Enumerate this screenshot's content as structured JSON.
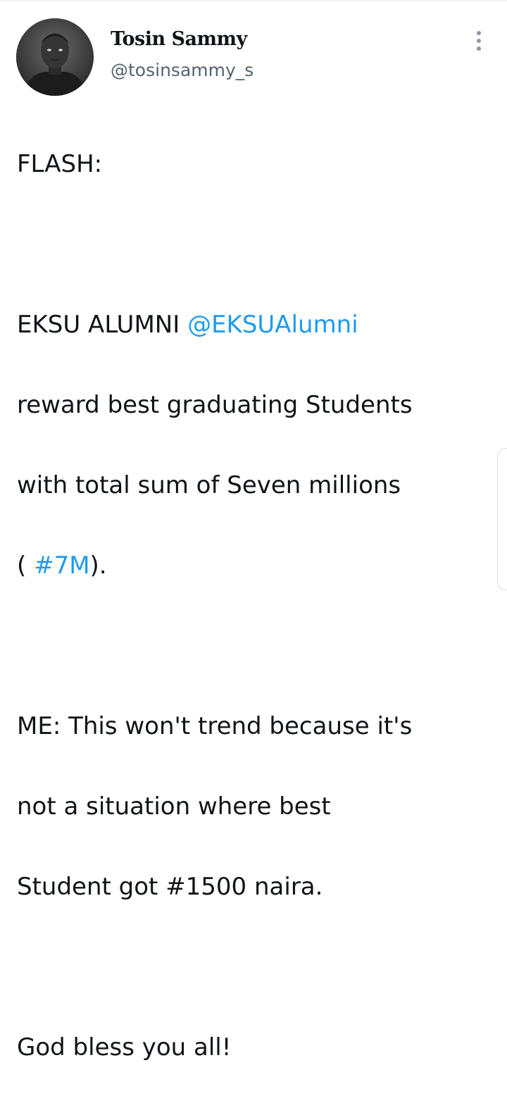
{
  "author": {
    "display_name": "Tosin Sammy",
    "handle": "@tosinsammy_s"
  },
  "icons": {
    "more": "more-vertical-icon",
    "avatar": "profile-photo"
  },
  "colors": {
    "link": "#1d9bf0",
    "text": "#0f1419",
    "secondary": "#536471"
  },
  "tweet": {
    "line1": "FLASH:",
    "line2_prefix": "EKSU ALUMNI ",
    "line2_mention": "@EKSUAlumni",
    "line3": "reward best graduating Students",
    "line4": "with total sum of Seven millions",
    "line5_open": "( ",
    "line5_hashtag": "#7M",
    "line5_close": ").",
    "line6": "ME: This won't trend because it's",
    "line7": "not a situation where best",
    "line8": "Student got #1500 naira.",
    "line9": "God bless you all!"
  }
}
